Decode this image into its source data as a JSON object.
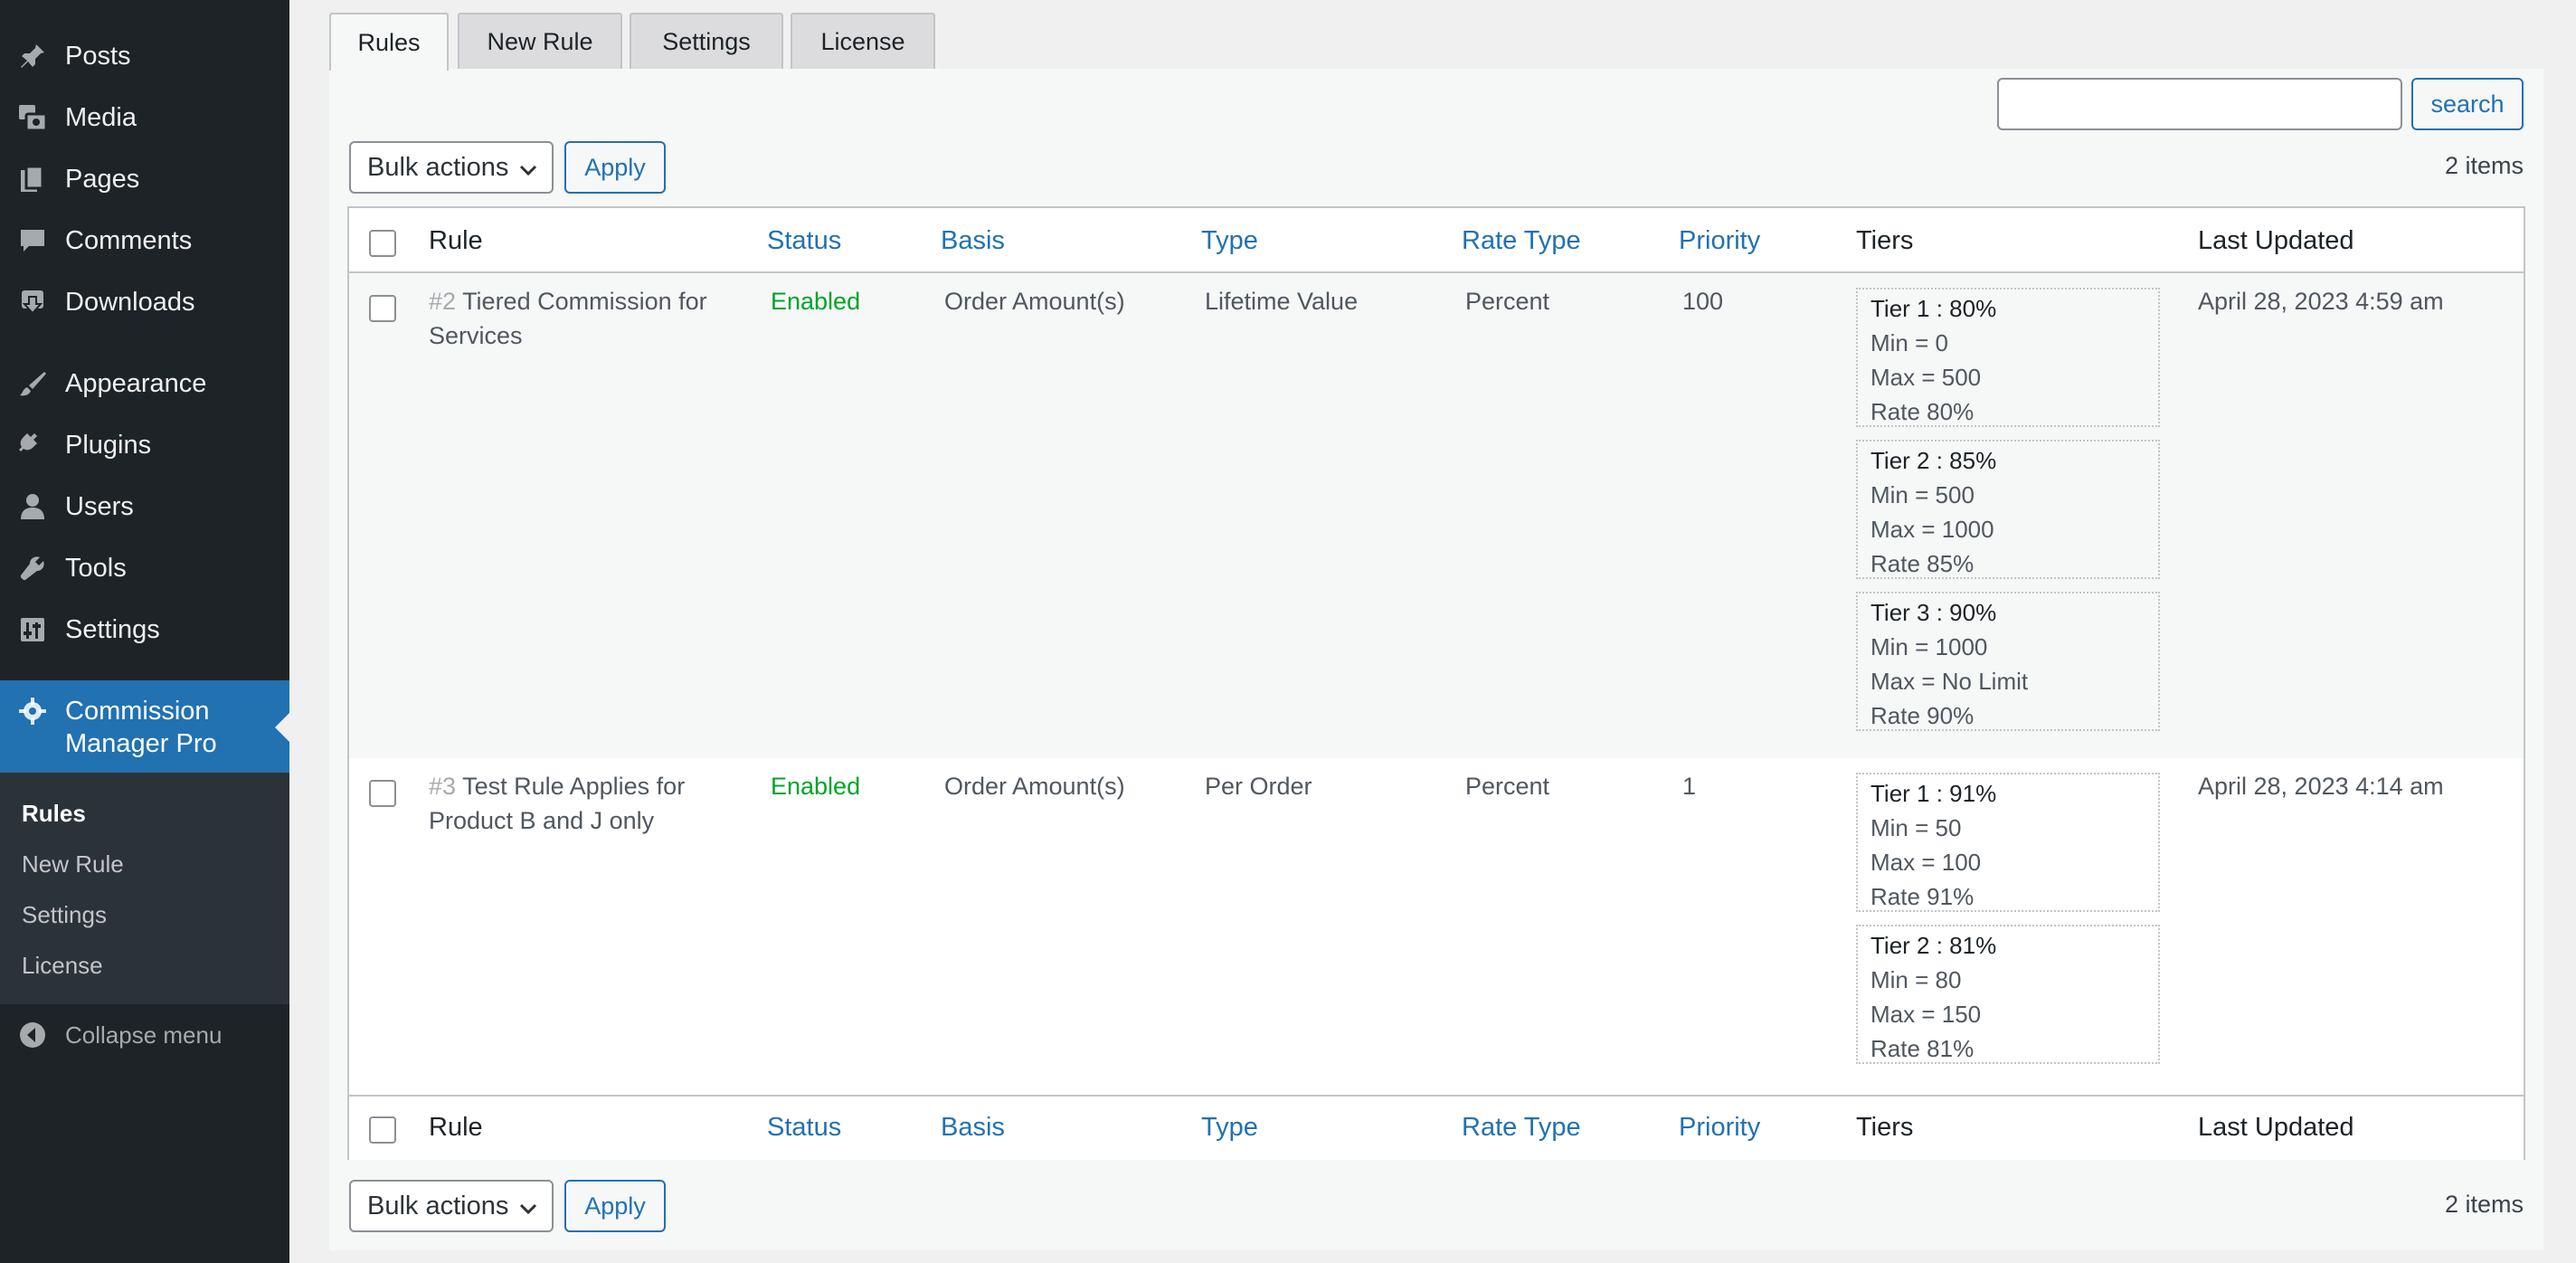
{
  "sidebar": {
    "items": [
      {
        "label": "Posts",
        "icon": "pin-icon"
      },
      {
        "label": "Media",
        "icon": "media-icon"
      },
      {
        "label": "Pages",
        "icon": "pages-icon"
      },
      {
        "label": "Comments",
        "icon": "comments-icon"
      },
      {
        "label": "Downloads",
        "icon": "download-icon"
      },
      {
        "label": "Appearance",
        "icon": "brush-icon"
      },
      {
        "label": "Plugins",
        "icon": "plug-icon"
      },
      {
        "label": "Users",
        "icon": "user-icon"
      },
      {
        "label": "Tools",
        "icon": "wrench-icon"
      },
      {
        "label": "Settings",
        "icon": "sliders-icon"
      }
    ],
    "current": {
      "label_line1": "Commission",
      "label_line2": "Manager Pro",
      "icon": "gear-icon"
    },
    "submenu": [
      "Rules",
      "New Rule",
      "Settings",
      "License"
    ],
    "collapse_label": "Collapse menu",
    "accent": "#2271b1"
  },
  "tabs": [
    "Rules",
    "New Rule",
    "Settings",
    "License"
  ],
  "search": {
    "value": "",
    "button": "search"
  },
  "bulk": {
    "select_label": "Bulk actions",
    "apply_label": "Apply"
  },
  "items_count": "2 items",
  "columns": {
    "rule": "Rule",
    "status": "Status",
    "basis": "Basis",
    "type": "Type",
    "rate_type": "Rate Type",
    "priority": "Priority",
    "tiers": "Tiers",
    "last_updated": "Last Updated"
  },
  "rows": [
    {
      "id": "#2",
      "name_line1": "Tiered Commission for",
      "name_line2": "Services",
      "status": "Enabled",
      "basis": "Order Amount(s)",
      "type": "Lifetime Value",
      "rate_type": "Percent",
      "priority": "100",
      "last_updated": "April 28, 2023 4:59 am",
      "tiers": [
        {
          "title": "Tier 1 : 80%",
          "min": "Min = 0",
          "max": "Max = 500",
          "rate": "Rate 80%"
        },
        {
          "title": "Tier 2 : 85%",
          "min": "Min = 500",
          "max": "Max = 1000",
          "rate": "Rate 85%"
        },
        {
          "title": "Tier 3 : 90%",
          "min": "Min = 1000",
          "max": "Max = No Limit",
          "rate": "Rate 90%"
        }
      ]
    },
    {
      "id": "#3",
      "name_line1": "Test Rule Applies for",
      "name_line2": "Product B and J only",
      "status": "Enabled",
      "basis": "Order Amount(s)",
      "type": "Per Order",
      "rate_type": "Percent",
      "priority": "1",
      "last_updated": "April 28, 2023 4:14 am",
      "tiers": [
        {
          "title": "Tier 1 : 91%",
          "min": "Min = 50",
          "max": "Max = 100",
          "rate": "Rate 91%"
        },
        {
          "title": "Tier 2 : 81%",
          "min": "Min = 80",
          "max": "Max = 150",
          "rate": "Rate 81%"
        }
      ]
    }
  ]
}
